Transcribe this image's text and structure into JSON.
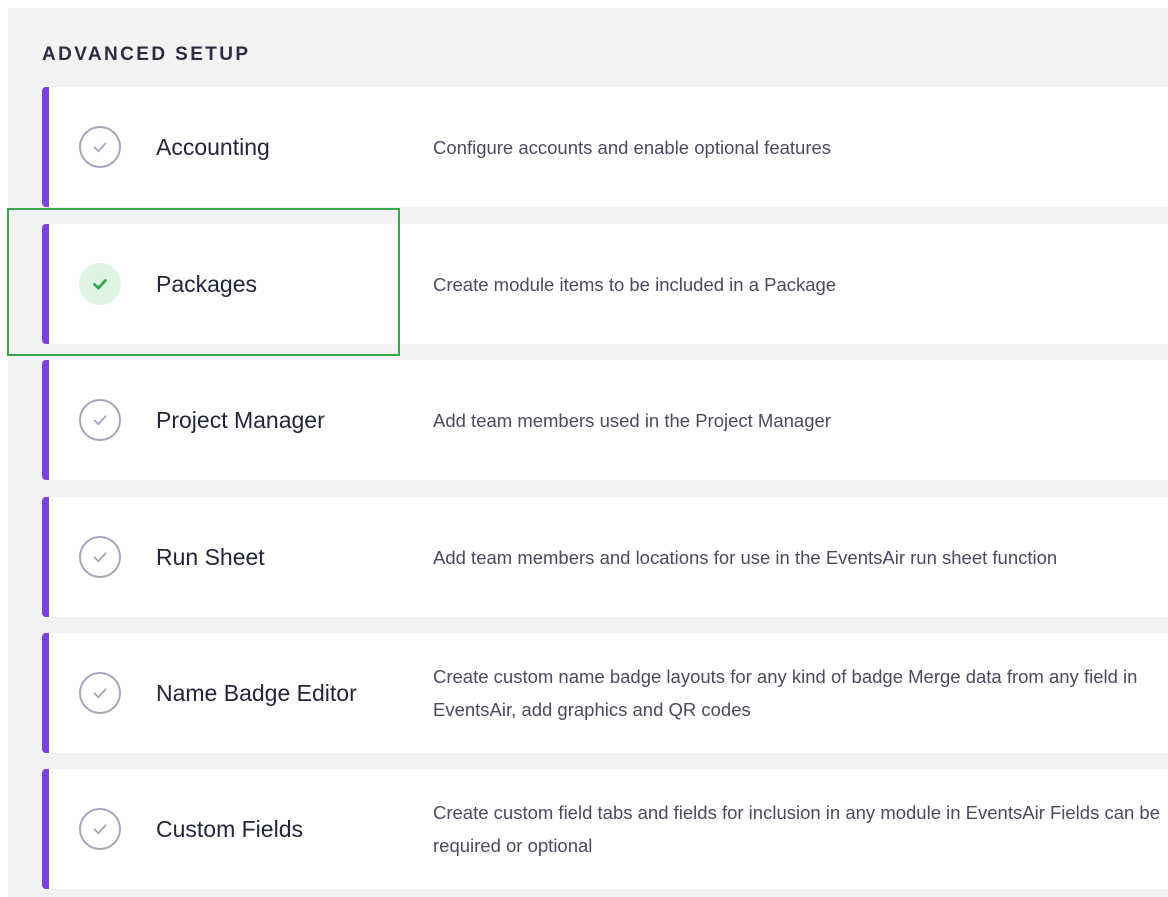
{
  "section": {
    "title": "ADVANCED SETUP"
  },
  "colors": {
    "accent": "#7b3fe4",
    "check_pending": "#a7a6bd",
    "check_done": "#2fa84f",
    "check_done_bg": "#def3e3",
    "highlight": "#3aa64e"
  },
  "rows": [
    {
      "label": "Accounting",
      "description": "Configure accounts and enable optional features",
      "completed": false,
      "icon": "check-circle-outline-icon"
    },
    {
      "label": "Packages",
      "description": "Create module items to be included in a Package",
      "completed": true,
      "icon": "check-circle-filled-icon"
    },
    {
      "label": "Project Manager",
      "description": "Add team members used in the Project Manager",
      "completed": false,
      "icon": "check-circle-outline-icon"
    },
    {
      "label": "Run Sheet",
      "description": "Add team members and locations for use in the EventsAir run sheet function",
      "completed": false,
      "icon": "check-circle-outline-icon"
    },
    {
      "label": "Name Badge Editor",
      "description": "Create custom name badge layouts for any kind of badge Merge data from any field in EventsAir, add graphics and QR codes",
      "completed": false,
      "icon": "check-circle-outline-icon"
    },
    {
      "label": "Custom Fields",
      "description": "Create custom field tabs and fields for inclusion in any module in EventsAir Fields can be required or optional",
      "completed": false,
      "icon": "check-circle-outline-icon"
    }
  ]
}
